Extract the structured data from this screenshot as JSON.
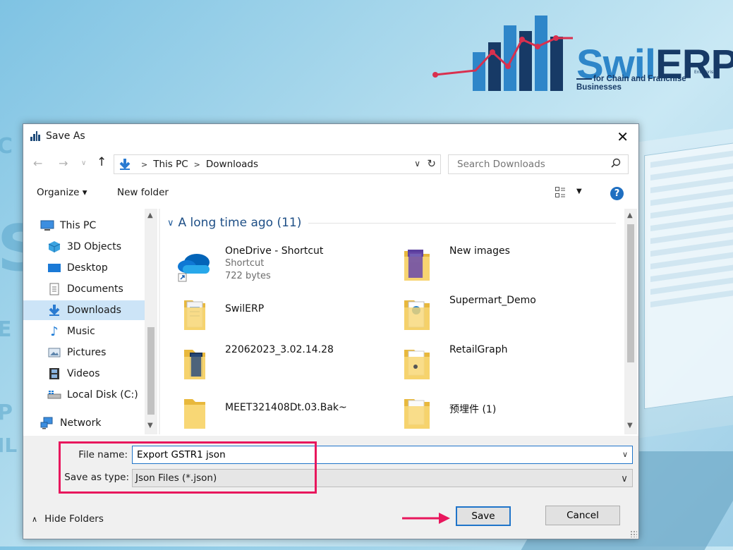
{
  "background": {
    "brand": {
      "name_part1": "Swil",
      "name_part2": "ERP",
      "tagline": "for Chain and Franchise Businesses",
      "small": "Enterprise"
    },
    "colors": {
      "brand_light": "#2e86c9",
      "brand_dark": "#173a66",
      "trend": "#d9304e"
    }
  },
  "dialog": {
    "title": "Save As",
    "address": {
      "path": [
        "This PC",
        "Downloads"
      ]
    },
    "search_placeholder": "Search Downloads",
    "toolbar": {
      "organize": "Organize ▾",
      "new_folder": "New folder"
    },
    "nav_items": [
      {
        "label": "This PC",
        "icon": "pc-icon"
      },
      {
        "label": "3D Objects",
        "icon": "cube-icon"
      },
      {
        "label": "Desktop",
        "icon": "desktop-icon"
      },
      {
        "label": "Documents",
        "icon": "document-icon"
      },
      {
        "label": "Downloads",
        "icon": "download-icon",
        "selected": true
      },
      {
        "label": "Music",
        "icon": "music-note-icon"
      },
      {
        "label": "Pictures",
        "icon": "pictures-icon"
      },
      {
        "label": "Videos",
        "icon": "film-icon"
      },
      {
        "label": "Local Disk (C:)",
        "icon": "drive-icon"
      },
      {
        "label": "Network",
        "icon": "network-icon"
      }
    ],
    "group_header": "A long time ago (11)",
    "files": [
      {
        "name": "OneDrive - Shortcut",
        "sub1": "Shortcut",
        "sub2": "722 bytes",
        "icon": "onedrive-icon"
      },
      {
        "name": "New images",
        "icon": "folder-icon"
      },
      {
        "name": "SwilERP",
        "icon": "folder-icon"
      },
      {
        "name": "Supermart_Demo",
        "icon": "folder-icon"
      },
      {
        "name": "22062023_3.02.14.28",
        "icon": "folder-icon"
      },
      {
        "name": "RetailGraph",
        "icon": "folder-icon"
      },
      {
        "name": "MEET321408Dt.03.Bak~",
        "icon": "folder-icon"
      },
      {
        "name": "预埋件 (1)",
        "icon": "folder-icon"
      }
    ],
    "file_name_label": "File name:",
    "file_name_value": "Export GSTR1 json",
    "save_type_label": "Save as type:",
    "save_type_value": "Json Files (*.json)",
    "hide_folders": "Hide Folders",
    "save_label": "Save",
    "cancel_label": "Cancel",
    "colors": {
      "accent": "#1f74c9",
      "selected": "#cce4f7",
      "highlight": "#e8175d"
    }
  }
}
